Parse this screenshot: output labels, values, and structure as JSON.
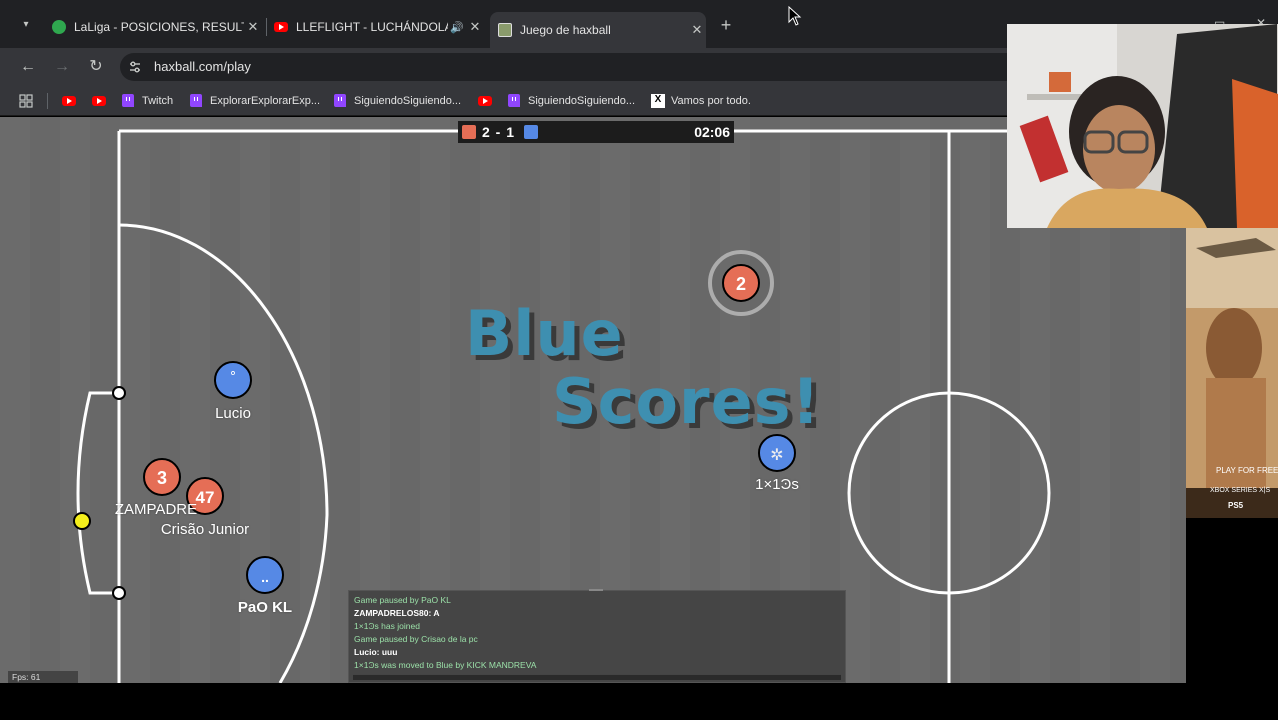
{
  "browser": {
    "tabs": [
      {
        "title": "LaLiga - POSICIONES, RESULTA",
        "icon": "laliga-favicon"
      },
      {
        "title": "LLEFLIGHT - LUCHÁNDOLA",
        "icon": "youtube-favicon"
      },
      {
        "title": "Juego de haxball",
        "icon": "haxball-favicon"
      }
    ],
    "url": "haxball.com/play",
    "bookmarks": [
      {
        "label": "",
        "icon": "youtube-icon"
      },
      {
        "label": "",
        "icon": "youtube-icon"
      },
      {
        "label": "Twitch",
        "icon": "twitch-icon"
      },
      {
        "label": "ExplorarExplorarExp...",
        "icon": "twitch-icon"
      },
      {
        "label": "SiguiendoSiguiendo...",
        "icon": "twitch-icon"
      },
      {
        "label": "",
        "icon": "youtube-icon"
      },
      {
        "label": "SiguiendoSiguiendo...",
        "icon": "twitch-icon"
      },
      {
        "label": "Vamos por todo.",
        "icon": "x-icon"
      }
    ]
  },
  "game": {
    "score": "2 - 1",
    "timer": "02:06",
    "red_color": "#e56e56",
    "blue_color": "#5689e5",
    "banner_line1": "Blue",
    "banner_line2": "Scores!",
    "players": [
      {
        "team": "red",
        "number": "2",
        "name": ""
      },
      {
        "team": "blue",
        "number": "",
        "name": "1×1Ͽs"
      },
      {
        "team": "blue",
        "number": "°",
        "name": "Lucio"
      },
      {
        "team": "red",
        "number": "3",
        "name": "ZAMPADRE"
      },
      {
        "team": "red",
        "number": "47",
        "name": "Crisão Junior"
      },
      {
        "team": "blue",
        "number": "..",
        "name": "PaO KL"
      }
    ],
    "chat": [
      {
        "text": "Game paused by PaO KL",
        "color": "#9be0a8"
      },
      {
        "text": "ZAMPADRELOS80: A",
        "color": "#ffffff"
      },
      {
        "text": "1×1Ͽs has joined",
        "color": "#9be0a8"
      },
      {
        "text": "Game paused by Crisao de la pc",
        "color": "#9be0a8"
      },
      {
        "text": "Lucio: uuu",
        "color": "#ffffff"
      },
      {
        "text": "1×1Ͽs was moved to Blue by KICK MANDREVA",
        "color": "#9be0a8"
      }
    ],
    "fps": "Fps: 61"
  },
  "ad": {
    "cta": "PLAY FOR FREE",
    "platform1": "XBOX SERIES X|S",
    "platform2": "PS5"
  }
}
